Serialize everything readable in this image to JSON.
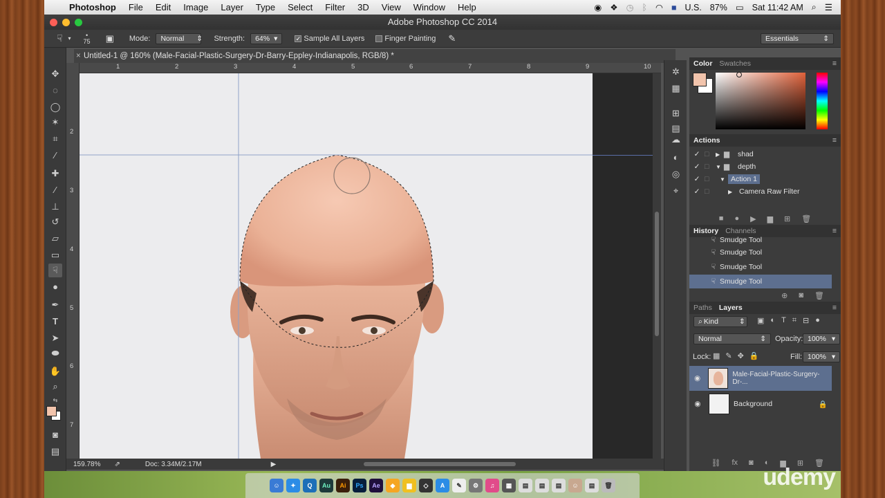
{
  "menubar": {
    "apple": "",
    "app": "Photoshop",
    "items": [
      "File",
      "Edit",
      "Image",
      "Layer",
      "Type",
      "Select",
      "Filter",
      "3D",
      "View",
      "Window",
      "Help"
    ],
    "input_source": "U.S.",
    "battery": "87%",
    "clock": "Sat 11:42 AM"
  },
  "window": {
    "title": "Adobe Photoshop CC 2014"
  },
  "options": {
    "brush_size": "75",
    "mode_label": "Mode:",
    "mode_value": "Normal",
    "strength_label": "Strength:",
    "strength_value": "64%",
    "sample_all_layers": "Sample All Layers",
    "finger_painting": "Finger Painting",
    "workspace": "Essentials"
  },
  "document": {
    "tab": "Untitled-1 @ 160% (Male-Facial-Plastic-Surgery-Dr-Barry-Eppley-Indianapolis, RGB/8) *",
    "ruler_h": [
      "1",
      "2",
      "3",
      "4",
      "5",
      "6",
      "7",
      "8",
      "9",
      "10"
    ],
    "ruler_v": [
      "2",
      "3",
      "4",
      "5",
      "6",
      "7"
    ]
  },
  "status": {
    "zoom": "159.78%",
    "doc": "Doc: 3.34M/2.17M"
  },
  "panels": {
    "color_tabs": [
      "Color",
      "Swatches"
    ],
    "actions_tab": "Actions",
    "actions": [
      {
        "label": "shad",
        "kind": "set",
        "expanded": false
      },
      {
        "label": "depth",
        "kind": "set",
        "expanded": true
      },
      {
        "label": "Action 1",
        "kind": "action",
        "expanded": true
      },
      {
        "label": "Camera Raw Filter",
        "kind": "step",
        "expanded": false
      }
    ],
    "history_tabs": [
      "History",
      "Channels"
    ],
    "history": [
      "Smudge Tool",
      "Smudge Tool",
      "Smudge Tool",
      "Smudge Tool"
    ],
    "layers_tabs": [
      "Paths",
      "Layers"
    ],
    "kind_filter": "Kind",
    "blend_mode": "Normal",
    "opacity_label": "Opacity:",
    "opacity": "100%",
    "lock_label": "Lock:",
    "fill_label": "Fill:",
    "fill": "100%",
    "layers": [
      {
        "name": "Male-Facial-Plastic-Surgery-Dr-...",
        "selected": true,
        "locked": false
      },
      {
        "name": "Background",
        "selected": false,
        "locked": true
      }
    ]
  },
  "colors": {
    "foreground": "#f2c4ac",
    "background": "#ffffff",
    "selection": "#5d6f8f"
  },
  "watermark": "udemy"
}
